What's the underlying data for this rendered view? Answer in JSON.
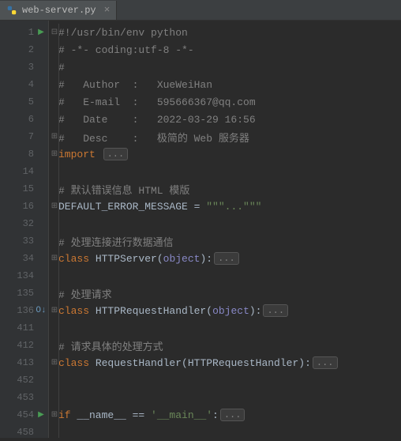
{
  "tab": {
    "filename": "web-server.py",
    "close_glyph": "×"
  },
  "gutter_marks": {
    "run": "▶",
    "override": "O↓"
  },
  "fold_glyphs": {
    "closed": "⊞",
    "open": "⊟"
  },
  "lines": [
    {
      "num": "1",
      "mark": "run",
      "fold": "open",
      "tokens": [
        [
          "comment",
          "#!/usr/bin/env python"
        ]
      ]
    },
    {
      "num": "2",
      "mark": "",
      "fold": "",
      "tokens": [
        [
          "comment",
          "# -*- coding:utf-8 -*-"
        ]
      ]
    },
    {
      "num": "3",
      "mark": "",
      "fold": "",
      "tokens": [
        [
          "comment",
          "#"
        ]
      ]
    },
    {
      "num": "4",
      "mark": "",
      "fold": "",
      "tokens": [
        [
          "comment",
          "#   Author  :   XueWeiHan"
        ]
      ]
    },
    {
      "num": "5",
      "mark": "",
      "fold": "",
      "tokens": [
        [
          "comment",
          "#   E-mail  :   595666367@qq.com"
        ]
      ]
    },
    {
      "num": "6",
      "mark": "",
      "fold": "",
      "tokens": [
        [
          "comment",
          "#   Date    :   2022-03-29 16:56"
        ]
      ]
    },
    {
      "num": "7",
      "mark": "",
      "fold": "closed",
      "tokens": [
        [
          "comment",
          "#   Desc    :   极简的 Web 服务器"
        ]
      ]
    },
    {
      "num": "8",
      "mark": "",
      "fold": "closed",
      "tokens": [
        [
          "keyword",
          "import "
        ]
      ],
      "folded": "..."
    },
    {
      "num": "14",
      "mark": "",
      "fold": "",
      "tokens": []
    },
    {
      "num": "15",
      "mark": "",
      "fold": "",
      "tokens": [
        [
          "comment",
          "# 默认错误信息 HTML 模版"
        ]
      ]
    },
    {
      "num": "16",
      "mark": "",
      "fold": "closed",
      "tokens": [
        [
          "var",
          "DEFAULT_ERROR_MESSAGE "
        ],
        [
          "default",
          "= "
        ],
        [
          "string",
          "\"\"\"...\"\"\""
        ]
      ]
    },
    {
      "num": "32",
      "mark": "",
      "fold": "",
      "tokens": []
    },
    {
      "num": "33",
      "mark": "",
      "fold": "",
      "tokens": [
        [
          "comment",
          "# 处理连接进行数据通信"
        ]
      ]
    },
    {
      "num": "34",
      "mark": "",
      "fold": "closed",
      "tokens": [
        [
          "keyword",
          "class "
        ],
        [
          "classname",
          "HTTPServer"
        ],
        [
          "default",
          "("
        ],
        [
          "builtin",
          "object"
        ],
        [
          "default",
          "):"
        ]
      ],
      "folded": "..."
    },
    {
      "num": "134",
      "mark": "",
      "fold": "",
      "tokens": []
    },
    {
      "num": "135",
      "mark": "",
      "fold": "",
      "tokens": [
        [
          "comment",
          "# 处理请求"
        ]
      ]
    },
    {
      "num": "136",
      "mark": "ovr",
      "fold": "closed",
      "tokens": [
        [
          "keyword",
          "class "
        ],
        [
          "classname",
          "HTTPRequestHandler"
        ],
        [
          "default",
          "("
        ],
        [
          "builtin",
          "object"
        ],
        [
          "default",
          "):"
        ]
      ],
      "folded": "..."
    },
    {
      "num": "411",
      "mark": "",
      "fold": "",
      "tokens": []
    },
    {
      "num": "412",
      "mark": "",
      "fold": "",
      "tokens": [
        [
          "comment",
          "# 请求具体的处理方式"
        ]
      ]
    },
    {
      "num": "413",
      "mark": "",
      "fold": "closed",
      "tokens": [
        [
          "keyword",
          "class "
        ],
        [
          "classname",
          "RequestHandler"
        ],
        [
          "default",
          "("
        ],
        [
          "classname",
          "HTTPRequestHandler"
        ],
        [
          "default",
          "):"
        ]
      ],
      "folded": "..."
    },
    {
      "num": "452",
      "mark": "",
      "fold": "",
      "tokens": []
    },
    {
      "num": "453",
      "mark": "",
      "fold": "",
      "tokens": []
    },
    {
      "num": "454",
      "mark": "run",
      "fold": "closed",
      "tokens": [
        [
          "keyword",
          "if "
        ],
        [
          "var",
          "__name__ "
        ],
        [
          "default",
          "== "
        ],
        [
          "string",
          "'__main__'"
        ],
        [
          "default",
          ":"
        ]
      ],
      "folded": "..."
    },
    {
      "num": "458",
      "mark": "",
      "fold": "",
      "tokens": []
    }
  ]
}
